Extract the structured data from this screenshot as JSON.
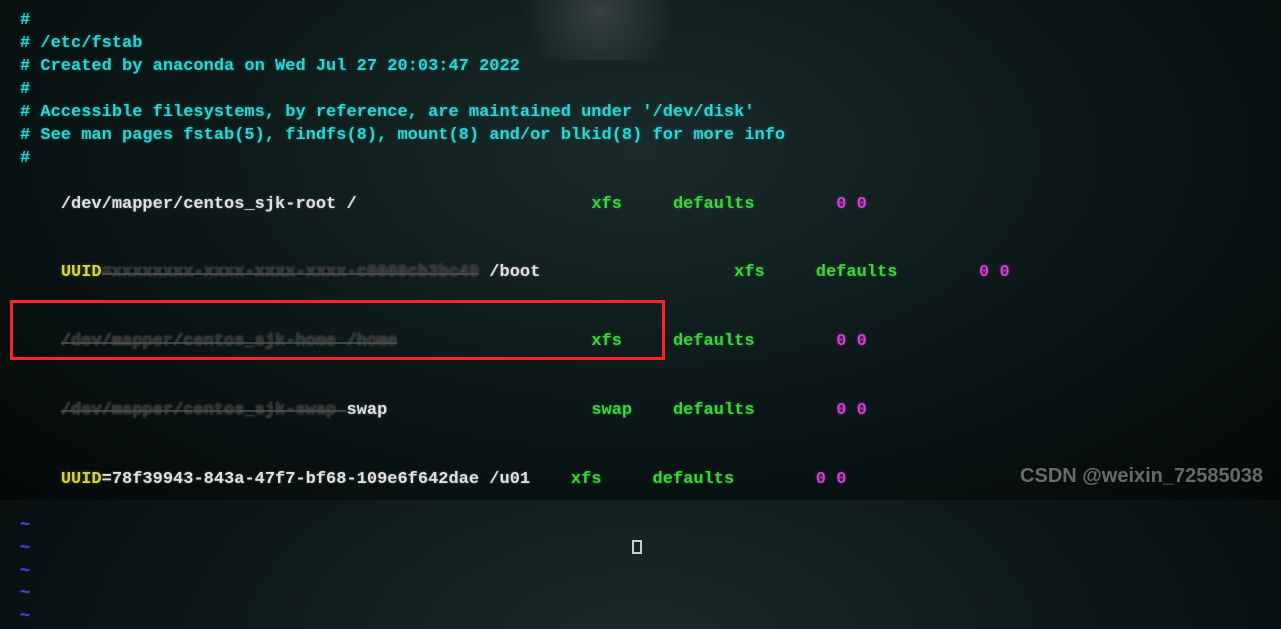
{
  "lines": [
    {
      "cls": "comment",
      "text": "#"
    },
    {
      "cls": "comment",
      "text": "# /etc/fstab"
    },
    {
      "cls": "comment",
      "text": "# Created by anaconda on Wed Jul 27 20:03:47 2022"
    },
    {
      "cls": "comment",
      "text": "#"
    },
    {
      "cls": "comment",
      "text": "# Accessible filesystems, by reference, are maintained under '/dev/disk'"
    },
    {
      "cls": "comment",
      "text": "# See man pages fstab(5), findfs(8), mount(8) and/or blkid(8) for more info"
    },
    {
      "cls": "comment",
      "text": "#"
    }
  ],
  "fstab_entries": [
    {
      "device": "/dev/mapper/centos_sjk-root",
      "mount": "/",
      "fs": "xfs",
      "opts": "defaults",
      "dump": "0",
      "pass": "0"
    },
    {
      "device_prefix": "UUID",
      "device": "=xxxxxxxx-xxxx-xxxx-xxxx-c0000cb3bc49",
      "mount": "/boot",
      "fs": "xfs",
      "opts": "defaults",
      "dump": "0",
      "pass": "0",
      "struck": true
    },
    {
      "device": "/dev/mapper/centos_sjk-home",
      "mount": "/home",
      "fs": "xfs",
      "opts": "defaults",
      "dump": "0",
      "pass": "0",
      "struck": true
    },
    {
      "device": "/dev/mapper/centos_sjk-swap",
      "mount": "swap",
      "fs": "swap",
      "opts": "defaults",
      "dump": "0",
      "pass": "0",
      "struck": true
    },
    {
      "device_prefix": "UUID",
      "device": "=78f39943-843a-47f7-bf68-109e6f642dae",
      "mount": "/u01",
      "fs": "xfs",
      "opts": "defaults",
      "dump": "0",
      "pass": "0",
      "highlighted": true
    }
  ],
  "tilde": "~",
  "watermark": "CSDN @weixin_72585038"
}
